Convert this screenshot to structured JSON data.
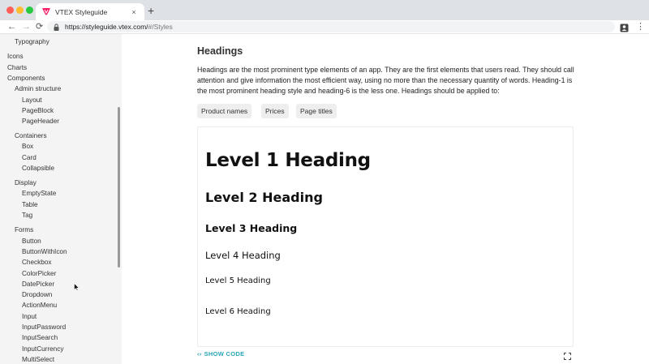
{
  "browser": {
    "tab_title": "VTEX Styleguide",
    "close_glyph": "×",
    "new_tab_glyph": "+",
    "url_host": "https://styleguide.vtex.com/",
    "url_path": "#/Styles",
    "icons": {
      "back": "←",
      "forward": "→",
      "reload": "⟳",
      "menu": "⋮"
    },
    "traffic_colors": [
      "#ff5f57",
      "#febc2e",
      "#28c840"
    ]
  },
  "sidebar": {
    "items": [
      "Typography",
      "Icons",
      "Charts",
      "Components",
      "Admin structure",
      "Layout",
      "PageBlock",
      "PageHeader",
      "Containers",
      "Box",
      "Card",
      "Collapsible",
      "Display",
      "EmptyState",
      "Table",
      "Tag",
      "Forms",
      "Button",
      "ButtonWithIcon",
      "Checkbox",
      "ColorPicker",
      "DatePicker",
      "Dropdown",
      "ActionMenu",
      "Input",
      "InputPassword",
      "InputSearch",
      "InputCurrency",
      "MultiSelect"
    ]
  },
  "main": {
    "title": "Headings",
    "description": "Headings are the most prominent type elements of an app. They are the first elements that users read. They should call attention and give information the most efficient way, using no more than the necessary quantity of words. Heading-1 is the most prominent heading style and heading-6 is the less one. Headings should be applied to:",
    "chips": [
      "Product names",
      "Prices",
      "Page titles"
    ],
    "levels": [
      "Level 1 Heading",
      "Level 2 Heading",
      "Level 3 Heading",
      "Level 4 Heading",
      "Level 5 Heading",
      "Level 6 Heading"
    ],
    "show_code_icon": "‹›",
    "show_code_label": "SHOW CODE",
    "accent_color": "#29a5b8"
  }
}
